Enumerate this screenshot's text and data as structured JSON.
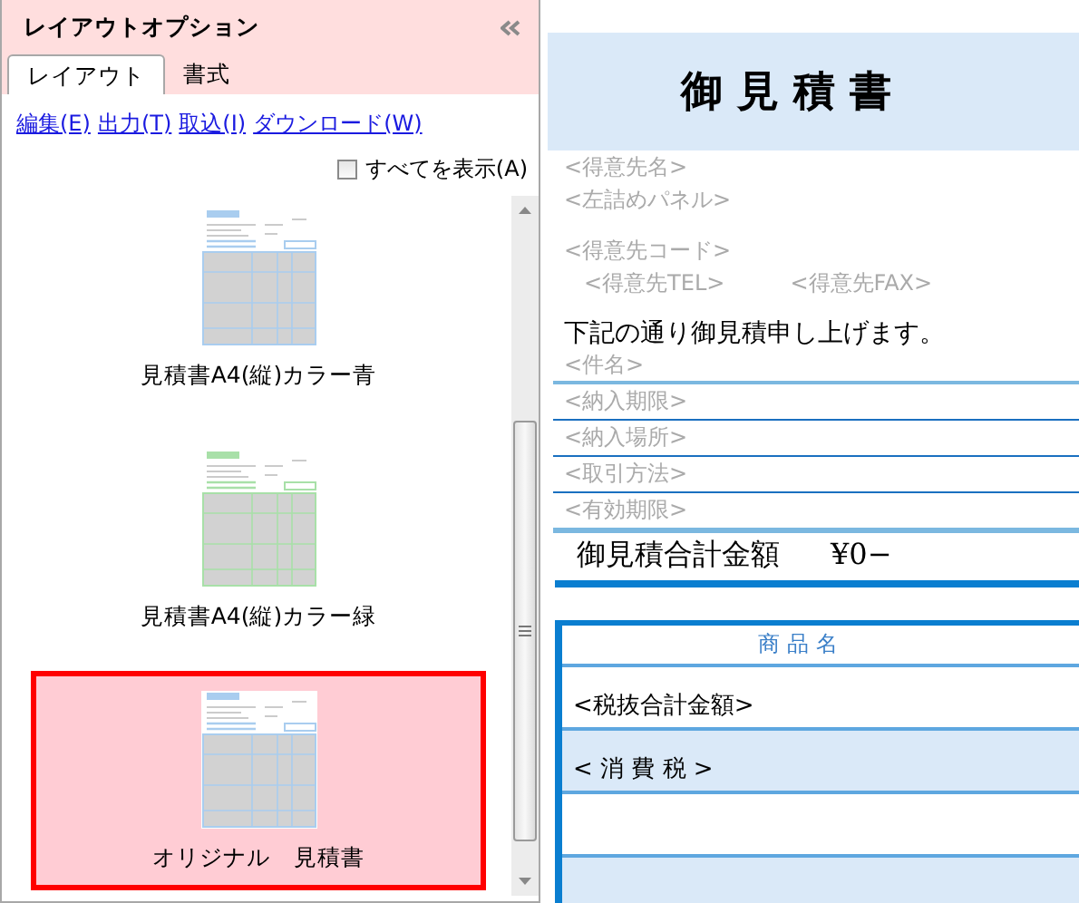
{
  "panel": {
    "title": "レイアウトオプション",
    "tabs": [
      {
        "label": "レイアウト",
        "selected": true
      },
      {
        "label": "書式",
        "selected": false
      }
    ],
    "links": [
      "編集(E)",
      "出力(T)",
      "取込(I)",
      "ダウンロード(W)"
    ],
    "show_all": {
      "label": "すべてを表示(A)",
      "checked": false
    },
    "layouts": [
      {
        "label": "見積書A4(縦)カラー青",
        "color": "#a9cdef",
        "selected": false
      },
      {
        "label": "見積書A4(縦)カラー緑",
        "color": "#a8e0a8",
        "selected": false
      },
      {
        "label": "オリジナル　見積書",
        "color": "#a9cdef",
        "selected": true
      }
    ]
  },
  "document": {
    "title": "御 見 積 書",
    "customer_lines": [
      "<得意先名>",
      "<左詰めパネル>"
    ],
    "customer_code": "<得意先コード>",
    "customer_tel": "<得意先TEL>",
    "customer_fax": "<得意先FAX>",
    "greeting": "下記の通り御見積申し上げます。",
    "fields": [
      "<件名>",
      "<納入期限>",
      "<納入場所>",
      "<取引方法>",
      "<有効期限>"
    ],
    "total_label": "御見積合計金額",
    "total_value": "¥0−",
    "table": {
      "header": "商 品 名",
      "rows": [
        {
          "label": "<税抜合計金額>",
          "shaded": false
        },
        {
          "label": "< 消 費 税 >",
          "shaded": true
        },
        {
          "label": "",
          "shaded": false
        },
        {
          "label": "",
          "shaded": true
        }
      ]
    }
  }
}
